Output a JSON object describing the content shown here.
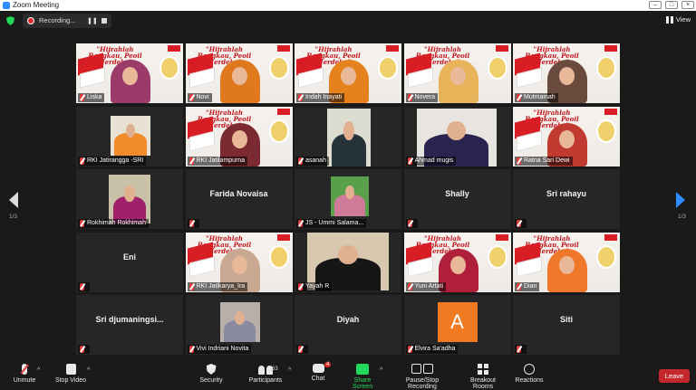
{
  "window": {
    "title": "Zoom Meeting"
  },
  "recording": {
    "label": "Recording...",
    "pause_icon": "pause-icon",
    "stop_icon": "stop-icon"
  },
  "view": {
    "label": "View"
  },
  "pagination": {
    "left": "1/3",
    "right": "1/3"
  },
  "tiles": [
    {
      "kind": "banner",
      "name": "Liska",
      "active": true,
      "shirt": "#9a3b6a"
    },
    {
      "kind": "banner",
      "name": "Novi",
      "shirt": "#e0781e"
    },
    {
      "kind": "banner",
      "name": "Indah Inayati",
      "shirt": "#e6821e"
    },
    {
      "kind": "banner",
      "name": "Novera",
      "shirt": "#e8b45a"
    },
    {
      "kind": "banner",
      "name": "Mutmainah",
      "shirt": "#6b4a3e"
    },
    {
      "kind": "photo",
      "name": "RKI Jatirangga -SRI",
      "shirt": "#f08a2a",
      "bg": "#e9e2d4"
    },
    {
      "kind": "banner",
      "name": "RKI Jatilampurna",
      "shirt": "#7a2a30"
    },
    {
      "kind": "photo",
      "name": "asanah",
      "shirt": "#26343a",
      "bg": "#dcdcd0"
    },
    {
      "kind": "photo",
      "name": "Ahmad mugis",
      "shirt": "#2a2550",
      "bg": "#e8e4e0"
    },
    {
      "kind": "banner",
      "name": "Ratna Sari Dewi",
      "shirt": "#c03a30"
    },
    {
      "kind": "photo",
      "name": "Rokhimah Rokhimah",
      "shirt": "#a0206a",
      "bg": "#c9c0a8"
    },
    {
      "kind": "name",
      "name": "Farida Novaisa"
    },
    {
      "kind": "photo",
      "name": "JS - Ummi Salama...",
      "shirt": "#d07a9a",
      "bg": "#5aa04a"
    },
    {
      "kind": "name",
      "name": "Shally"
    },
    {
      "kind": "name",
      "name": "Sri rahayu"
    },
    {
      "kind": "name",
      "name": "Eni"
    },
    {
      "kind": "banner",
      "name": "RKI Jatikarya_Ira",
      "shirt": "#c8a890"
    },
    {
      "kind": "photo",
      "name": "Yayah R",
      "shirt": "#161616",
      "bg": "#d8c8b0"
    },
    {
      "kind": "banner",
      "name": "Yuni Artati",
      "shirt": "#b0203a"
    },
    {
      "kind": "banner",
      "name": "Dian",
      "shirt": "#f0782a"
    },
    {
      "kind": "name",
      "name": "Sri  djumaningsi..."
    },
    {
      "kind": "photo",
      "name": "Vivi Indriani Novita",
      "shirt": "#8a8aa0",
      "bg": "#b8b0a8"
    },
    {
      "kind": "name",
      "name": "Diyah"
    },
    {
      "kind": "avatar",
      "name": "Elvira Sa'adha",
      "letter": "A",
      "color": "#f07a22"
    },
    {
      "kind": "name",
      "name": "Siti"
    }
  ],
  "banner_text": "\"Hijrahlah Bangkau, Peoil Merdeka\"",
  "toolbar": {
    "unmute": "Unmute",
    "stop_video": "Stop Video",
    "security": "Security",
    "participants": "Participants",
    "participants_count": "63",
    "chat": "Chat",
    "chat_badge": "4",
    "share_screen": "Share Screen",
    "record": "Pause/Stop Recording",
    "breakout": "Breakout Rooms",
    "reactions": "Reactions",
    "leave": "Leave"
  },
  "colors": {
    "accent": "#2d8cff",
    "leave": "#c4282d",
    "share": "#23d959",
    "active_border": "#d8e23a"
  }
}
